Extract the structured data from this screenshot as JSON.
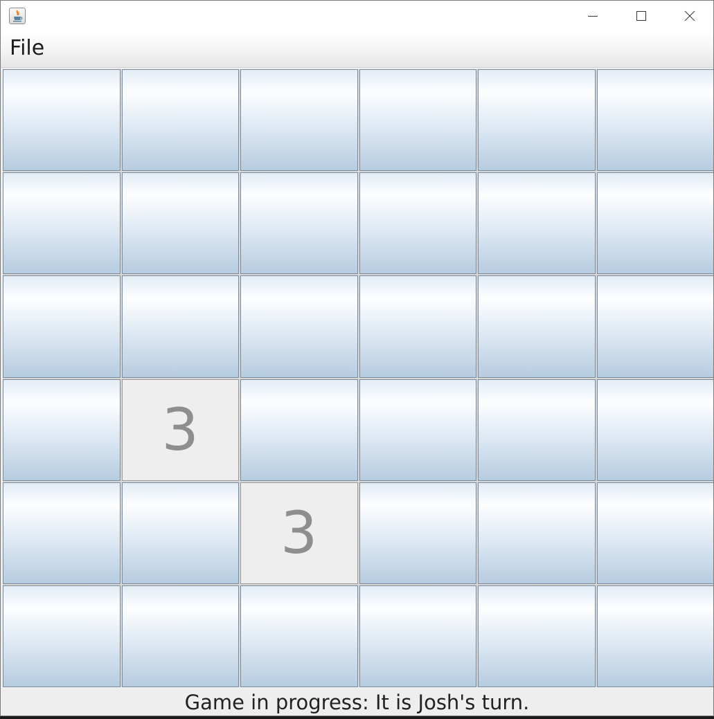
{
  "window": {
    "icon": "java-cup-icon",
    "controls": [
      "minimize-icon",
      "maximize-icon",
      "close-icon"
    ]
  },
  "menu": {
    "items": [
      {
        "label": "File"
      }
    ]
  },
  "board": {
    "rows": 6,
    "cols": 6,
    "cells": [
      [
        "",
        "",
        "",
        "",
        "",
        ""
      ],
      [
        "",
        "",
        "",
        "",
        "",
        ""
      ],
      [
        "",
        "",
        "",
        "",
        "",
        ""
      ],
      [
        "",
        "3",
        "",
        "",
        "",
        ""
      ],
      [
        "",
        "",
        "3",
        "",
        "",
        ""
      ],
      [
        "",
        "",
        "",
        "",
        "",
        ""
      ]
    ],
    "revealed": [
      [
        3,
        1
      ],
      [
        4,
        2
      ]
    ]
  },
  "status": {
    "text": "Game in progress: It is Josh's turn."
  }
}
